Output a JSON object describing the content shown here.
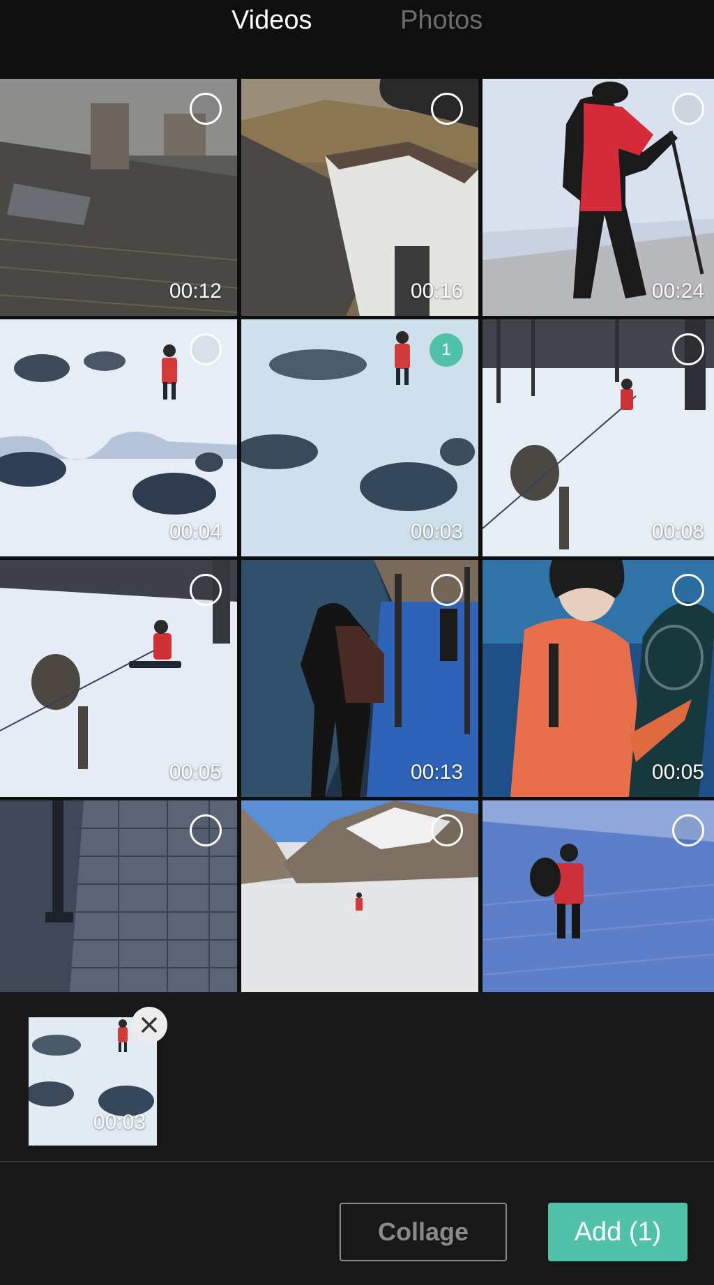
{
  "tabs": [
    {
      "label": "Videos",
      "active": true
    },
    {
      "label": "Photos",
      "active": false
    }
  ],
  "accent_color": "#4fc2a9",
  "grid": [
    {
      "duration": "00:12",
      "selected": false
    },
    {
      "duration": "00:16",
      "selected": false
    },
    {
      "duration": "00:24",
      "selected": false
    },
    {
      "duration": "00:04",
      "selected": false
    },
    {
      "duration": "00:03",
      "selected": true,
      "selection_number": "1"
    },
    {
      "duration": "00:08",
      "selected": false
    },
    {
      "duration": "00:05",
      "selected": false
    },
    {
      "duration": "00:13",
      "selected": false
    },
    {
      "duration": "00:05",
      "selected": false
    },
    {
      "duration": "",
      "selected": false
    },
    {
      "duration": "",
      "selected": false
    },
    {
      "duration": "",
      "selected": false
    }
  ],
  "tray": {
    "items": [
      {
        "duration": "00:03"
      }
    ]
  },
  "buttons": {
    "collage": "Collage",
    "add": "Add (1)"
  }
}
